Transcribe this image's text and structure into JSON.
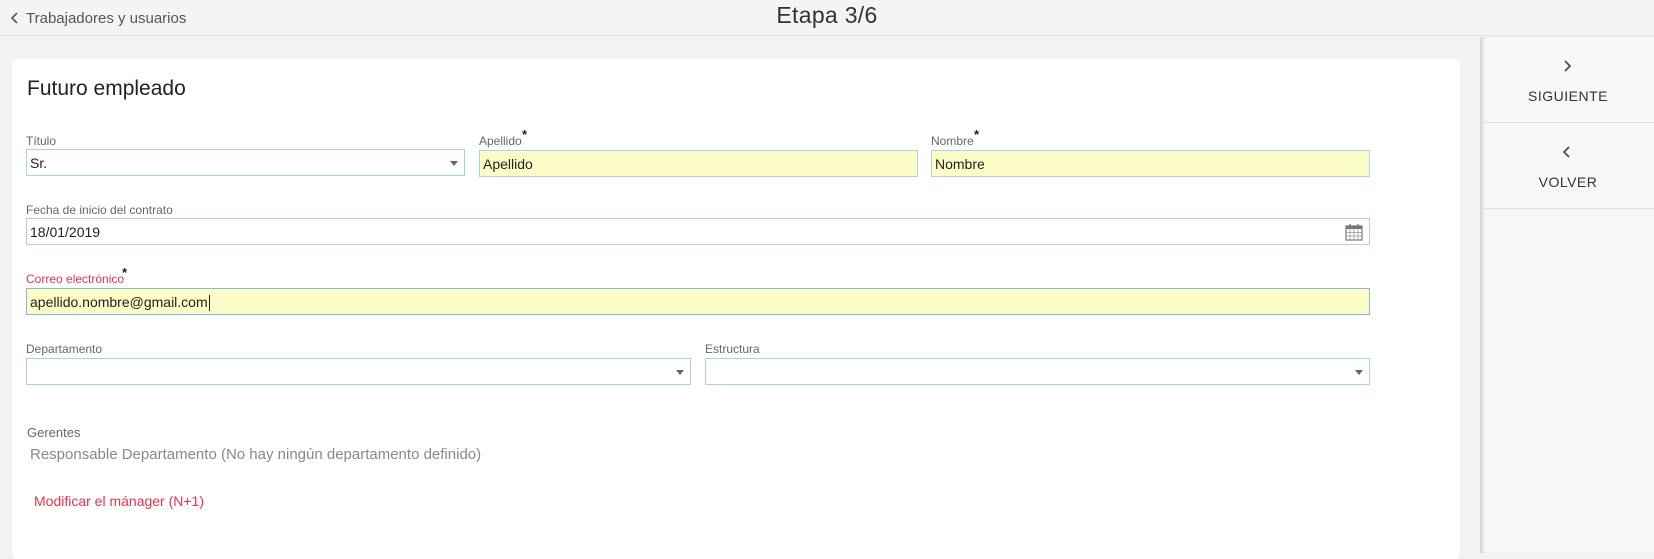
{
  "header": {
    "back_label": "Trabajadores y usuarios",
    "step_title": "Etapa 3/6"
  },
  "form": {
    "title": "Futuro empleado",
    "titulo": {
      "label": "Título",
      "value": "Sr."
    },
    "apellido": {
      "label": "Apellido",
      "required_mark": "*",
      "value": "Apellido"
    },
    "nombre": {
      "label": "Nombre",
      "required_mark": "*",
      "value": "Nombre"
    },
    "fecha": {
      "label": "Fecha de inicio del contrato",
      "value": "18/01/2019"
    },
    "correo": {
      "label": "Correo electrónico",
      "required_mark": "*",
      "value": "apellido.nombre@gmail.com"
    },
    "departamento": {
      "label": "Departamento",
      "value": ""
    },
    "estructura": {
      "label": "Estructura",
      "value": ""
    },
    "gerentes": {
      "label": "Gerentes",
      "text": "Responsable Departamento (No hay ningún departamento definido)"
    },
    "modify_link": "Modificar el mánager (N+1)"
  },
  "sidebar": {
    "next_label": "SIGUIENTE",
    "back_label": "VOLVER"
  },
  "colors": {
    "required_field_bg": "#fcfdc6",
    "input_border": "#a9d3ec",
    "error_accent": "#e8334a"
  }
}
